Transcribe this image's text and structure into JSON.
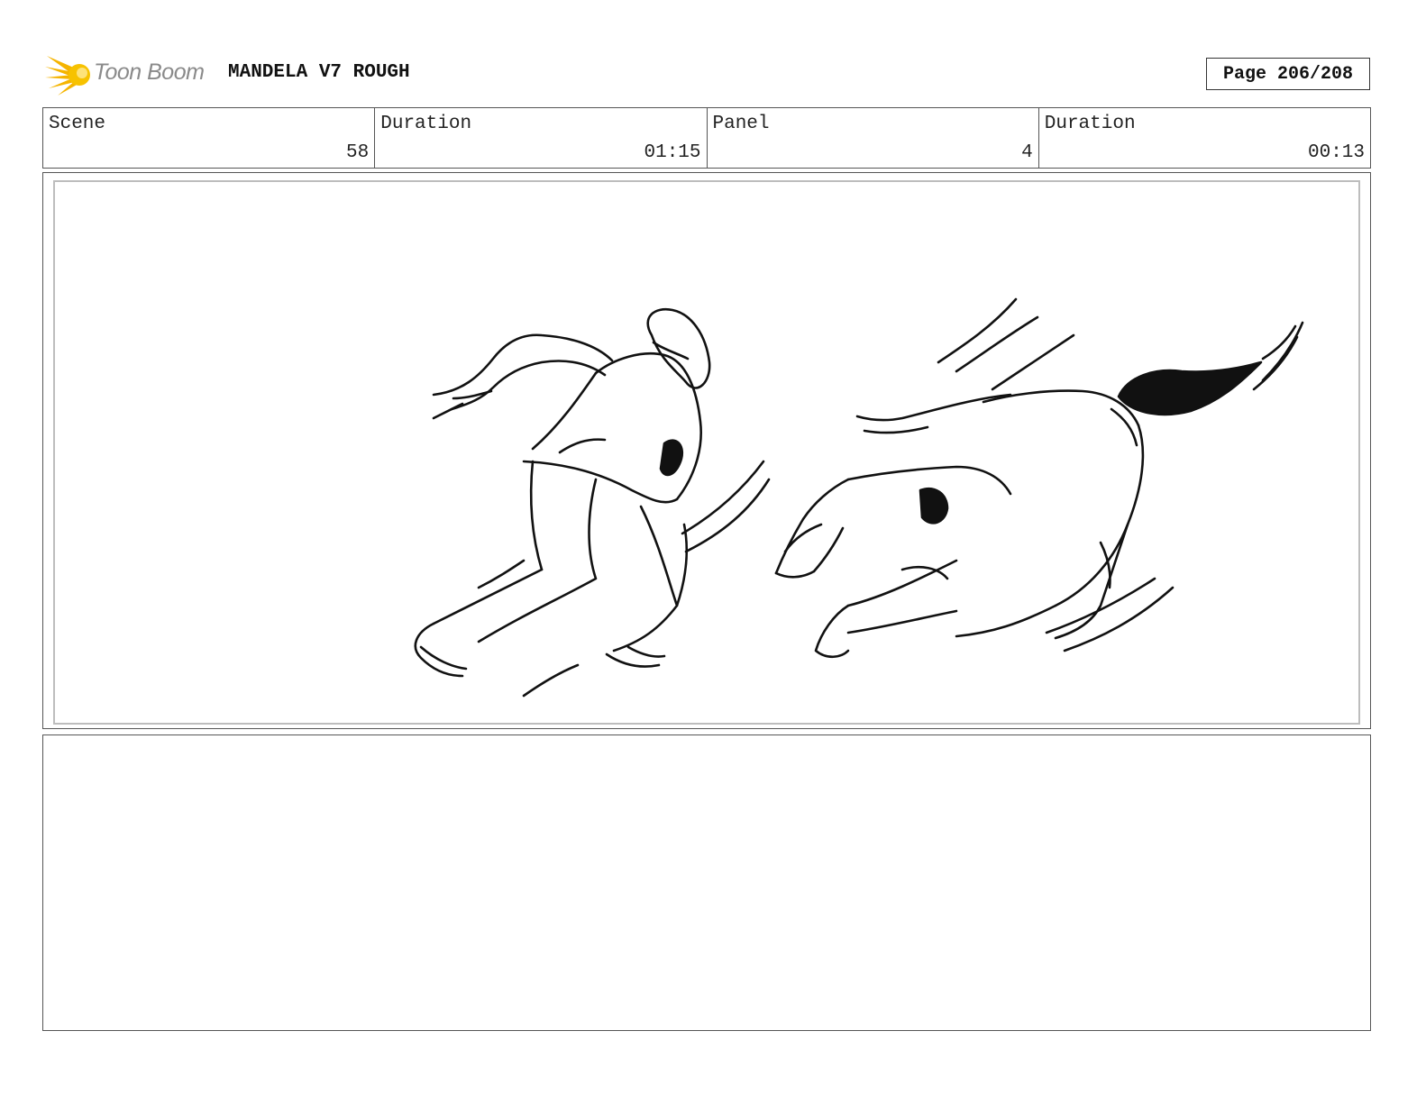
{
  "header": {
    "logo_text": "Toon Boom",
    "project_title": "MANDELA V7 ROUGH",
    "page_label": "Page 206/208"
  },
  "info": {
    "scene_label": "Scene",
    "scene_value": "58",
    "scene_duration_label": "Duration",
    "scene_duration_value": "01:15",
    "panel_label": "Panel",
    "panel_value": "4",
    "panel_duration_label": "Duration",
    "panel_duration_value": "00:13"
  },
  "notes": {
    "text": ""
  }
}
